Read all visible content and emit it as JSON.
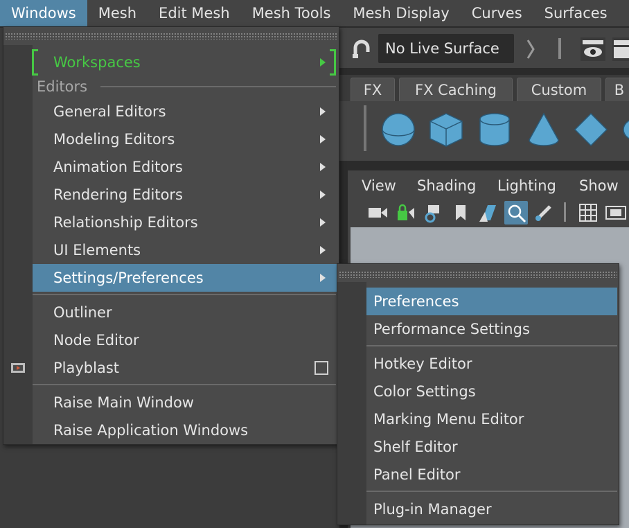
{
  "menubar": {
    "items": [
      "Windows",
      "Mesh",
      "Edit Mesh",
      "Mesh Tools",
      "Mesh Display",
      "Curves",
      "Surfaces"
    ],
    "active_index": 0
  },
  "status_line": {
    "live_surface": "No Live Surface"
  },
  "shelf": {
    "tabs": [
      "FX",
      "FX Caching",
      "Custom",
      "B"
    ],
    "primitives": [
      "sphere-icon",
      "cube-icon",
      "cylinder-icon",
      "cone-icon",
      "plane-icon",
      "torus-icon"
    ]
  },
  "panel": {
    "menus": [
      "View",
      "Shading",
      "Lighting",
      "Show"
    ]
  },
  "windows_menu": {
    "workspaces": "Workspaces",
    "editors_label": "Editors",
    "items": [
      {
        "label": "General Editors",
        "submenu": true
      },
      {
        "label": "Modeling Editors",
        "submenu": true
      },
      {
        "label": "Animation Editors",
        "submenu": true
      },
      {
        "label": "Rendering Editors",
        "submenu": true
      },
      {
        "label": "Relationship Editors",
        "submenu": true
      },
      {
        "label": "UI Elements",
        "submenu": true
      },
      {
        "label": "Settings/Preferences",
        "submenu": true,
        "highlighted": true
      }
    ],
    "items2": [
      "Outliner",
      "Node Editor",
      "Playblast"
    ],
    "items3": [
      "Raise Main Window",
      "Raise Application Windows"
    ]
  },
  "settings_submenu": {
    "group1": [
      "Preferences",
      "Performance Settings"
    ],
    "group2": [
      "Hotkey Editor",
      "Color Settings",
      "Marking Menu Editor",
      "Shelf Editor",
      "Panel Editor"
    ],
    "group3": [
      "Plug-in Manager"
    ],
    "highlighted": "Preferences"
  },
  "colors": {
    "highlight": "#5285a6",
    "workspaces_green": "#46c844",
    "menu_bg": "#4a4a4a",
    "primitive_blue": "#5aa6d0"
  }
}
